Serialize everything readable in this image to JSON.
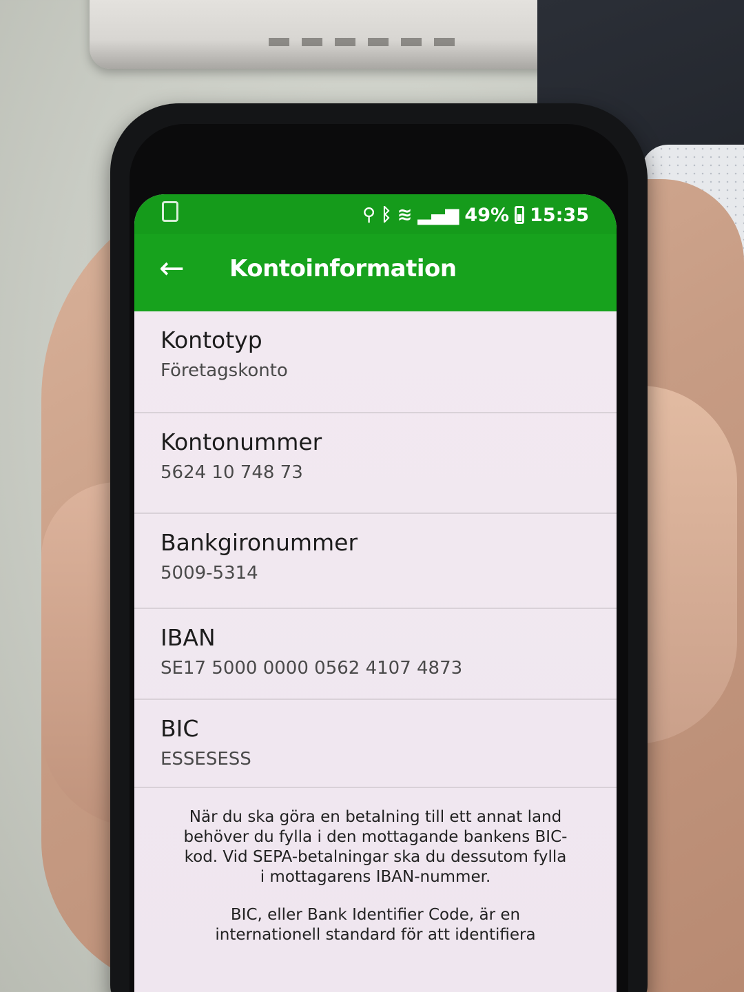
{
  "status_bar": {
    "battery_percent": "49%",
    "time": "15:35",
    "icons": [
      "sim-card-icon",
      "location-icon",
      "bluetooth-icon",
      "wifi-icon",
      "signal-icon",
      "battery-icon"
    ]
  },
  "app_bar": {
    "back_icon": "arrow-left-icon",
    "title": "Kontoinformation"
  },
  "account_info": [
    {
      "label": "Kontotyp",
      "value": "Företagskonto"
    },
    {
      "label": "Kontonummer",
      "value": "5624 10 748 73"
    },
    {
      "label": "Bankgironummer",
      "value": "5009-5314"
    },
    {
      "label": "IBAN",
      "value": "SE17 5000 0000 0562 4107 4873"
    },
    {
      "label": "BIC",
      "value": "ESSESESS"
    }
  ],
  "info_paragraphs": [
    "När du ska göra en betalning till ett annat land behöver du fylla i den mottagande bankens BIC-kod. Vid SEPA-betalningar ska du dessutom fylla i mottagarens IBAN-nummer.",
    "BIC, eller Bank Identifier Code, är en internationell standard för att identifiera"
  ],
  "colors": {
    "app_bar": "#17a21d",
    "status_bar": "#159b1b",
    "screen_background": "#f1e8f0"
  }
}
